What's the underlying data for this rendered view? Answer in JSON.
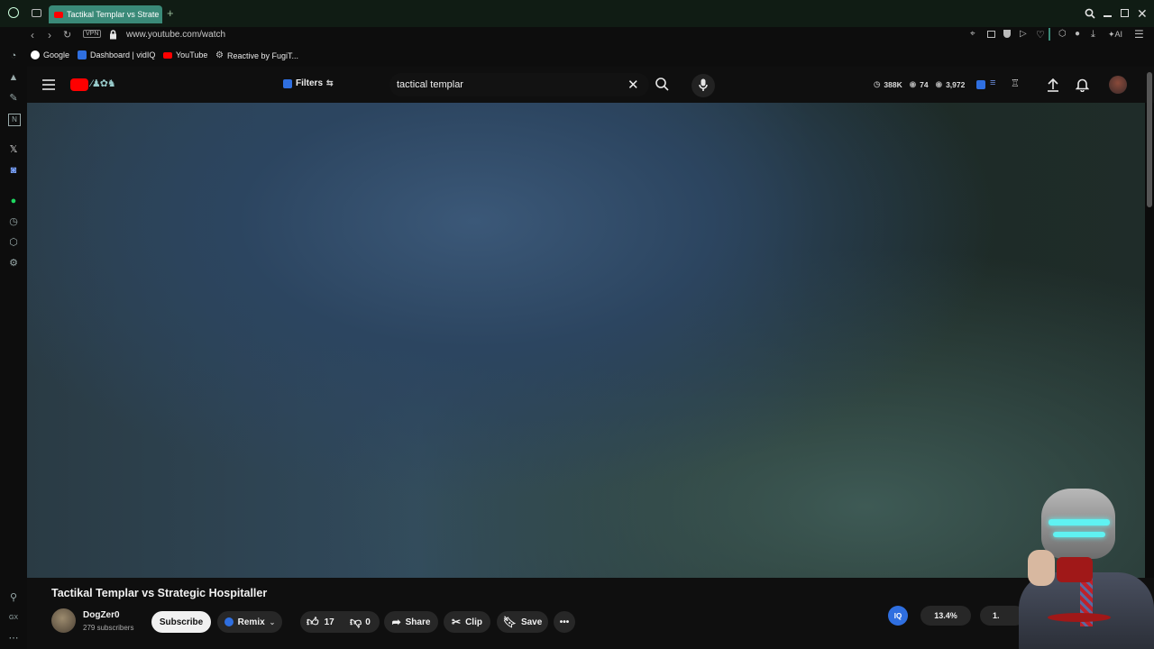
{
  "browser": {
    "tab_title": "Tactikal Templar vs Strate",
    "url": "www.youtube.com/watch",
    "vpn_label": "VPN",
    "ai_label": "AI",
    "bookmarks": [
      {
        "label": "Google",
        "icon": "google-icon"
      },
      {
        "label": "Dashboard | vidIQ",
        "icon": "vidiq-icon"
      },
      {
        "label": "YouTube",
        "icon": "youtube-icon"
      },
      {
        "label": "Reactive by FugiT...",
        "icon": "gear-icon"
      }
    ],
    "sidebar_bottom_label": "GX"
  },
  "youtube": {
    "filters_label": "Filters",
    "search_value": "tactical templar",
    "stats": {
      "views": "388K",
      "likes_short": "74",
      "count": "3,972"
    },
    "video_title": "Tactikal Templar vs Strategic Hospitaller",
    "channel": {
      "name": "DogZer0",
      "subscribers": "279 subscribers"
    },
    "subscribe_label": "Subscribe",
    "remix_label": "Remix",
    "likes": "17",
    "dislikes": "0",
    "share_label": "Share",
    "clip_label": "Clip",
    "save_label": "Save",
    "vidiq_percent": "13.4%",
    "vidiq_trailing": "1."
  },
  "colors": {
    "tab_active": "#3a8a78",
    "youtube_red": "#ff0000",
    "vidiq_blue": "#2f6fe0"
  }
}
